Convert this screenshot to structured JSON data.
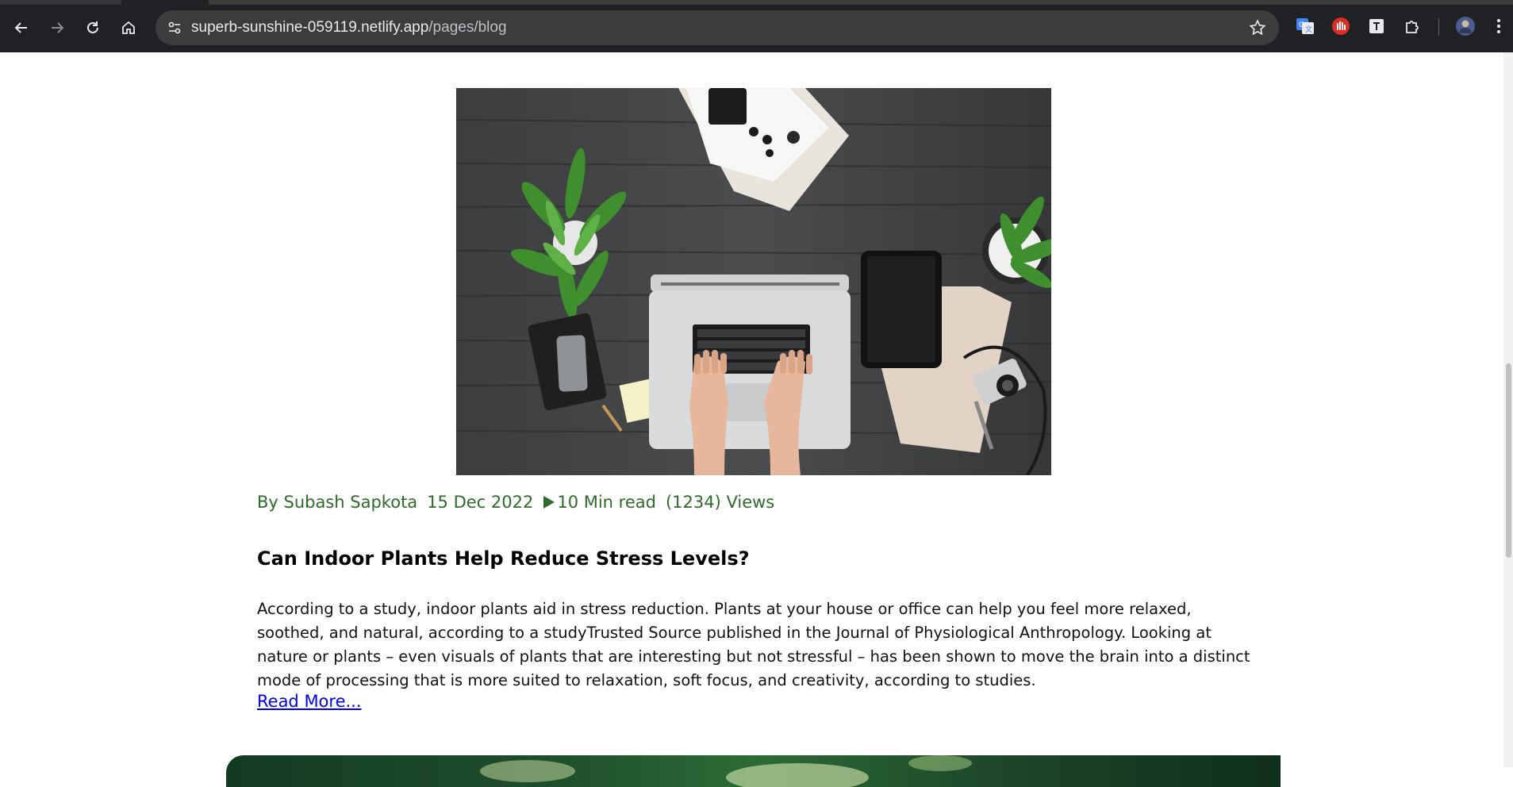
{
  "browser": {
    "url_domain": "superb-sunshine-059119.netlify.app",
    "url_path": "/pages/blog",
    "icons": {
      "back": "arrow-left-icon",
      "forward": "arrow-right-icon",
      "reload": "reload-icon",
      "home": "home-icon",
      "site_info": "tune-icon",
      "bookmark": "star-icon",
      "extensions": [
        "google-translate-icon",
        "red-hand-extension-icon",
        "text-extension-icon",
        "puzzle-icon"
      ],
      "profile": "profile-avatar-icon",
      "menu": "kebab-menu-icon"
    }
  },
  "post": {
    "image_alt": "Top view of a person typing on a laptop on a dark wooden desk with plants, tablet, phone, notebook and camera",
    "author": "By Subash Sapkota",
    "date": "15 Dec 2022",
    "read_time": "10 Min read",
    "views": "(1234) Views",
    "title": "Can Indoor Plants Help Reduce Stress Levels?",
    "body": "According to a study, indoor plants aid in stress reduction. Plants at your house or office can help you feel more relaxed, soothed, and natural, according to a studyTrusted Source published in the Journal of Physiological Anthropology. Looking at nature or plants – even visuals of plants that are interesting but not stressful – has been shown to move the brain into a distinct mode of processing that is more suited to relaxation, soft focus, and creativity, according to studies.",
    "read_more": "Read More..."
  },
  "colors": {
    "meta_green": "#2e6b2a",
    "link_blue": "#0000ee",
    "chrome_bg": "#202124",
    "omnibox_bg": "#3c3c3c"
  }
}
